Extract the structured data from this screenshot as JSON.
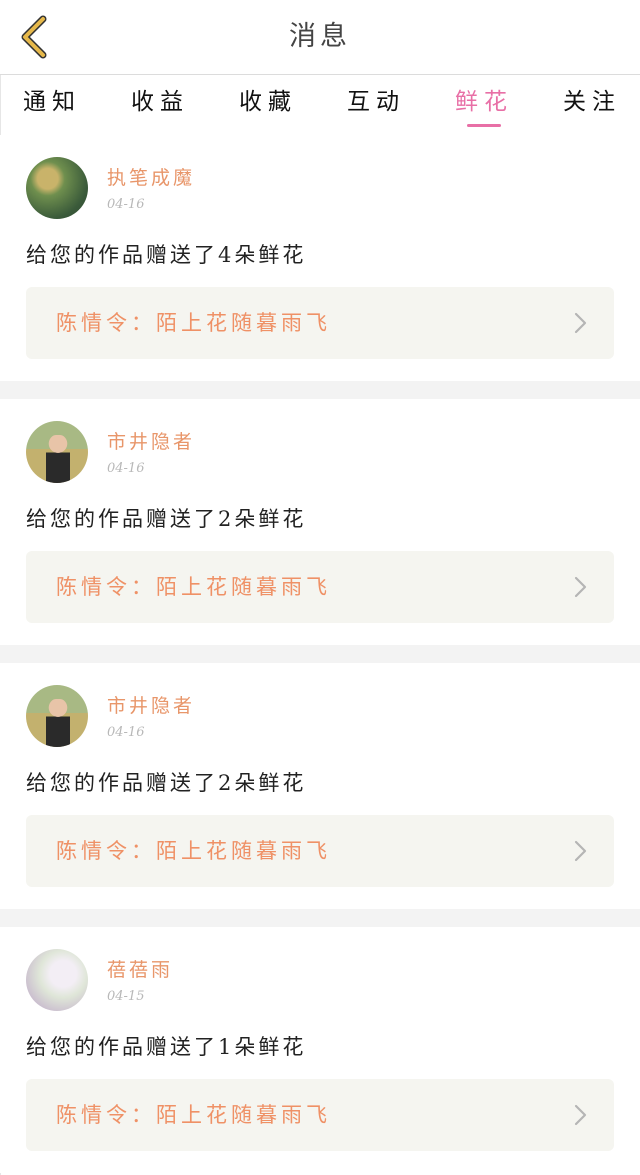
{
  "header": {
    "title": "消息",
    "back_icon": "chevron-left-icon",
    "back_color": "#e6b84a"
  },
  "tabs": [
    {
      "label": "通知",
      "active": false
    },
    {
      "label": "收益",
      "active": false
    },
    {
      "label": "收藏",
      "active": false
    },
    {
      "label": "互动",
      "active": false
    },
    {
      "label": "鲜花",
      "active": true
    },
    {
      "label": "关注",
      "active": false
    }
  ],
  "colors": {
    "accent": "#e86fa6",
    "username": "#e8966a",
    "work_title": "#ef9166",
    "card_bg": "#f5f5f0"
  },
  "notifications": [
    {
      "username": "执笔成魔",
      "date": "04-16",
      "message": "给您的作品赠送了4朵鲜花",
      "work": "陈情令：陌上花随暮雨飞"
    },
    {
      "username": "市井隐者",
      "date": "04-16",
      "message": "给您的作品赠送了2朵鲜花",
      "work": "陈情令：陌上花随暮雨飞"
    },
    {
      "username": "市井隐者",
      "date": "04-16",
      "message": "给您的作品赠送了2朵鲜花",
      "work": "陈情令：陌上花随暮雨飞"
    },
    {
      "username": "蓓蓓雨",
      "date": "04-15",
      "message": "给您的作品赠送了1朵鲜花",
      "work": "陈情令：陌上花随暮雨飞"
    }
  ]
}
